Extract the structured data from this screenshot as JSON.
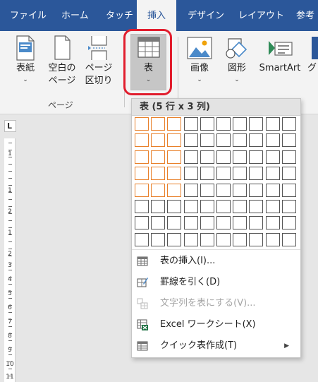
{
  "tabs": [
    {
      "label": "ファイル"
    },
    {
      "label": "ホーム"
    },
    {
      "label": "タッチ"
    },
    {
      "label": "挿入"
    },
    {
      "label": "デザイン"
    },
    {
      "label": "レイアウト"
    },
    {
      "label": "参考"
    }
  ],
  "active_tab": "挿入",
  "ribbon": {
    "cover_page": "表紙",
    "blank_page_line1": "空白の",
    "blank_page_line2": "ページ",
    "page_break_line1": "ページ",
    "page_break_line2": "区切り",
    "pages_group_label": "ページ",
    "table": "表",
    "pictures": "画像",
    "shapes": "図形",
    "smartart": "SmartArt",
    "truncated_next": "グ"
  },
  "table_dropdown": {
    "header": "表 (5 行 x 3 列)",
    "grid_columns": 10,
    "grid_rows": 8,
    "selected_rows": 5,
    "selected_columns": 3,
    "menu_items": [
      {
        "label": "表の挿入(I)...",
        "icon": "insert-table-icon",
        "enabled": true,
        "submenu": false
      },
      {
        "label": "罫線を引く(D)",
        "icon": "draw-table-icon",
        "enabled": true,
        "submenu": false
      },
      {
        "label": "文字列を表にする(V)...",
        "icon": "convert-text-to-table-icon",
        "enabled": false,
        "submenu": false
      },
      {
        "label": "Excel ワークシート(X)",
        "icon": "excel-spreadsheet-icon",
        "enabled": true,
        "submenu": false
      },
      {
        "label": "クイック表作成(T)",
        "icon": "quick-tables-icon",
        "enabled": true,
        "submenu": true
      }
    ]
  },
  "ruler": {
    "corner_symbol": "L",
    "numbers": [
      "1",
      "1",
      "2",
      "1",
      "2",
      "3",
      "4",
      "5",
      "6",
      "7",
      "8",
      "9",
      "10",
      "11"
    ]
  },
  "colors": {
    "tab_bar": "#2b579a",
    "highlight_box": "#e11d2d",
    "selected_cell_border": "#e8802a",
    "excel_green": "#217346"
  }
}
